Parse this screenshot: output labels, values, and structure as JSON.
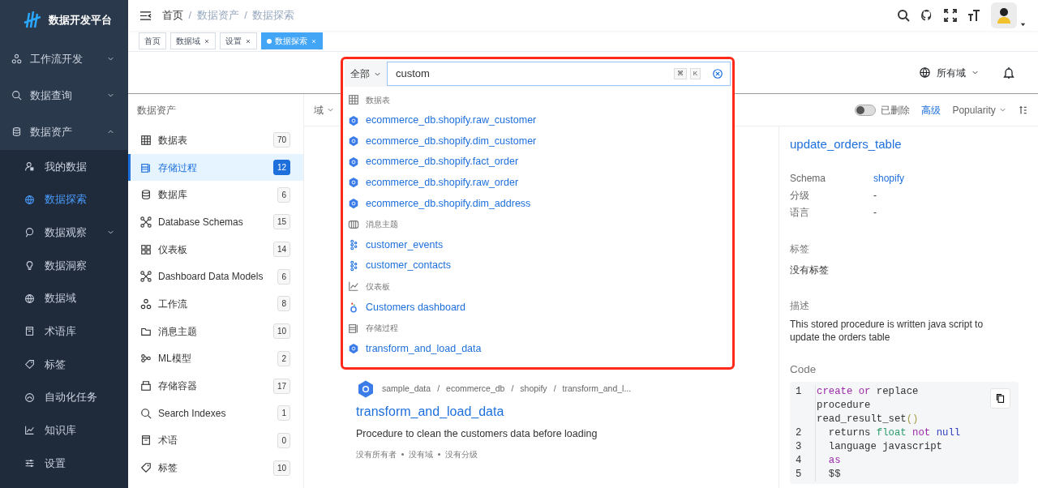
{
  "app": {
    "title": "数据开发平台"
  },
  "sidebar": {
    "items": [
      {
        "label": "工作流开发",
        "expanded": false
      },
      {
        "label": "数据查询",
        "expanded": false
      },
      {
        "label": "数据资产",
        "expanded": true,
        "children": [
          {
            "label": "我的数据",
            "selected": false
          },
          {
            "label": "数据探索",
            "selected": true
          },
          {
            "label": "数据观察",
            "selected": false,
            "expanded": false
          },
          {
            "label": "数据洞察",
            "selected": false
          },
          {
            "label": "数据域",
            "selected": false
          },
          {
            "label": "术语库",
            "selected": false
          },
          {
            "label": "标签",
            "selected": false
          },
          {
            "label": "自动化任务",
            "selected": false
          },
          {
            "label": "知识库",
            "selected": false
          },
          {
            "label": "设置",
            "selected": false
          }
        ]
      }
    ]
  },
  "header": {
    "separator": "/",
    "breadcrumb": [
      {
        "label": "首页",
        "current": false
      },
      {
        "label": "数据资产",
        "current": true
      },
      {
        "label": "数据探索",
        "current": true
      }
    ]
  },
  "tabs": [
    {
      "label": "首页",
      "closable": false,
      "selected": false
    },
    {
      "label": "数据域",
      "closable": true,
      "selected": false
    },
    {
      "label": "设置",
      "closable": true,
      "selected": false
    },
    {
      "label": "数据探索",
      "closable": true,
      "selected": true
    }
  ],
  "search": {
    "scope": "全部",
    "value": "custom",
    "keys": [
      "⌘",
      "K"
    ],
    "domain": "所有域"
  },
  "assets": {
    "title": "数据资产",
    "items": [
      {
        "label": "数据表",
        "count": "70",
        "selected": false
      },
      {
        "label": "存储过程",
        "count": "12",
        "selected": true
      },
      {
        "label": "数据库",
        "count": "6",
        "selected": false
      },
      {
        "label": "Database Schemas",
        "count": "15",
        "selected": false
      },
      {
        "label": "仪表板",
        "count": "14",
        "selected": false
      },
      {
        "label": "Dashboard Data Models",
        "count": "6",
        "selected": false
      },
      {
        "label": "工作流",
        "count": "8",
        "selected": false
      },
      {
        "label": "消息主题",
        "count": "10",
        "selected": false
      },
      {
        "label": "ML模型",
        "count": "2",
        "selected": false
      },
      {
        "label": "存储容器",
        "count": "17",
        "selected": false
      },
      {
        "label": "Search Indexes",
        "count": "1",
        "selected": false
      },
      {
        "label": "术语",
        "count": "0",
        "selected": false
      },
      {
        "label": "标签",
        "count": "10",
        "selected": false
      }
    ]
  },
  "toolbar": {
    "filter": "域",
    "deleted": {
      "label": "已删除",
      "on": false
    },
    "advanced": "高级",
    "sort": "Popularity"
  },
  "suggestions": [
    {
      "group": "数据表",
      "items": [
        "ecommerce_db.shopify.raw_customer",
        "ecommerce_db.shopify.dim_customer",
        "ecommerce_db.shopify.fact_order",
        "ecommerce_db.shopify.raw_order",
        "ecommerce_db.shopify.dim_address"
      ]
    },
    {
      "group": "消息主题",
      "items": [
        "customer_events",
        "customer_contacts"
      ]
    },
    {
      "group": "仪表板",
      "items": [
        "Customers dashboard"
      ]
    },
    {
      "group": "存储过程",
      "items": [
        "transform_and_load_data"
      ]
    }
  ],
  "result": {
    "separator": "/",
    "path": [
      "sample_data",
      "ecommerce_db",
      "shopify",
      "transform_and_l..."
    ],
    "title": "transform_and_load_data",
    "description": "Procedure to clean the customers data before loading",
    "meta": [
      "没有所有者",
      "没有域",
      "没有分级"
    ]
  },
  "detail": {
    "title": "update_orders_table",
    "fields": [
      {
        "label": "Schema",
        "value": "shopify",
        "link": true
      },
      {
        "label": "分级",
        "value": "-",
        "link": false
      },
      {
        "label": "语言",
        "value": "-",
        "link": false
      }
    ],
    "tags_label": "标签",
    "tags_value": "没有标签",
    "description_label": "描述",
    "description": "This stored procedure is written java script to update the orders table",
    "code_label": "Code",
    "code": [
      {
        "number": "1",
        "tokens": [
          {
            "text": "create",
            "kind": "keyword"
          },
          {
            "text": " or",
            "kind": "keyword"
          },
          {
            "text": " replace procedure read_result_set",
            "kind": "plain"
          },
          {
            "text": "()",
            "kind": "punct"
          }
        ]
      },
      {
        "number": "2",
        "tokens": [
          {
            "text": "  returns ",
            "kind": "plain"
          },
          {
            "text": "float",
            "kind": "type"
          },
          {
            "text": " not",
            "kind": "keyword"
          },
          {
            "text": " null",
            "kind": "literal"
          }
        ]
      },
      {
        "number": "3",
        "tokens": [
          {
            "text": "  language javascript",
            "kind": "plain"
          }
        ]
      },
      {
        "number": "4",
        "tokens": [
          {
            "text": "  as",
            "kind": "keyword"
          }
        ]
      },
      {
        "number": "5",
        "tokens": [
          {
            "text": "  $$",
            "kind": "plain"
          }
        ]
      }
    ]
  }
}
